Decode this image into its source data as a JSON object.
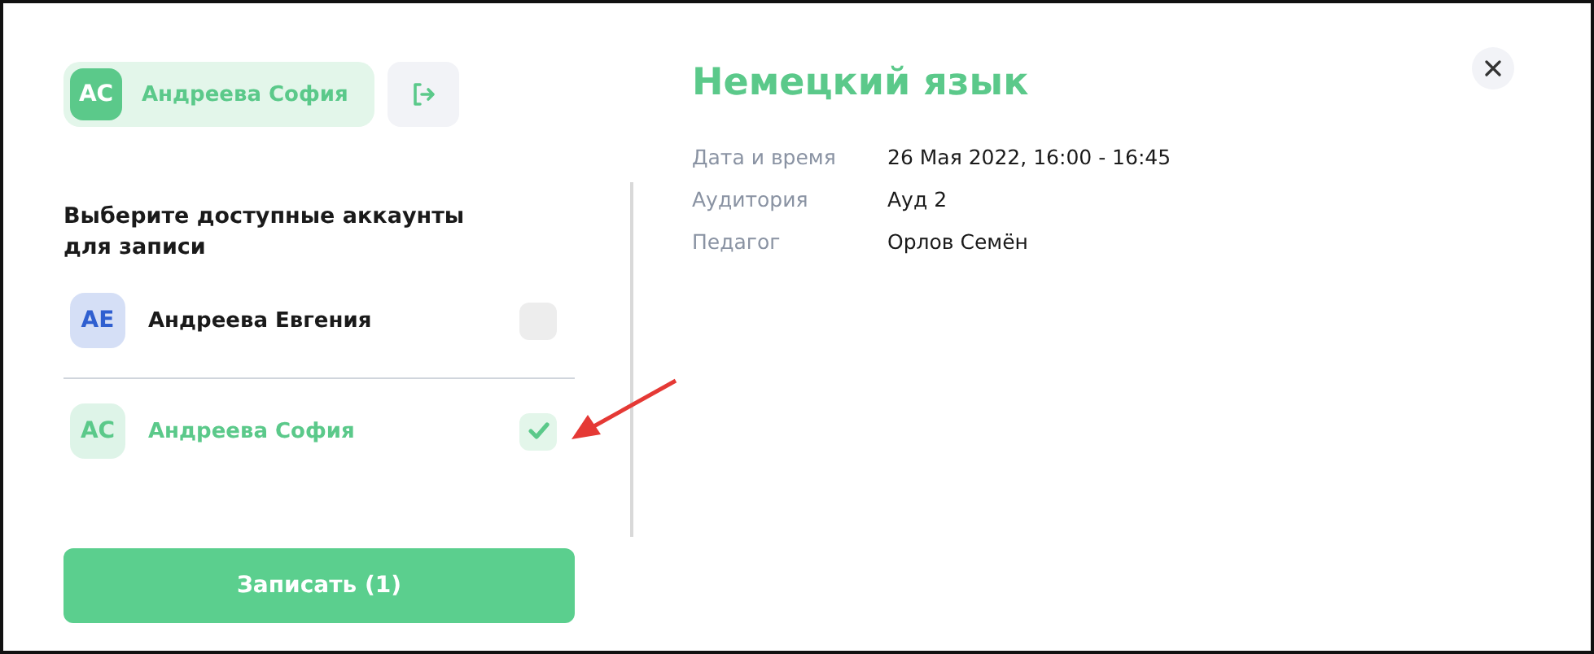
{
  "current_account": {
    "initials": "АС",
    "name": "Андреева София"
  },
  "accounts_heading": "Выберите доступные аккаунты для записи",
  "accounts": [
    {
      "initials": "АЕ",
      "name": "Андреева Евгения",
      "color": "#2f5fd0",
      "checked": false
    },
    {
      "initials": "АС",
      "name": "Андреева София",
      "color": "#5bc98a",
      "checked": true
    }
  ],
  "submit_button": "Записать (1)",
  "lesson": {
    "title": "Немецкий язык",
    "details": [
      {
        "label": "Дата и время",
        "value": "26 Мая 2022, 16:00 - 16:45"
      },
      {
        "label": "Аудитория",
        "value": "Ауд 2"
      },
      {
        "label": "Педагог",
        "value": "Орлов Семён"
      }
    ]
  },
  "annotations": [
    {
      "kind": "arrow"
    }
  ]
}
